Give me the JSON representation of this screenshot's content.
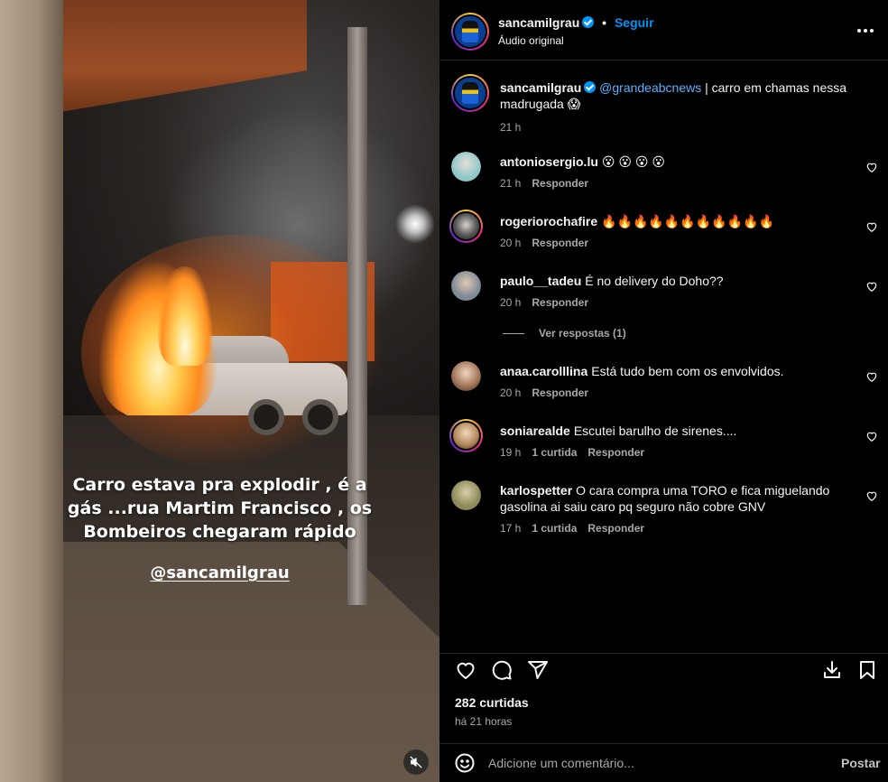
{
  "video": {
    "caption_lines": [
      "Carro estava pra explodir , é a",
      "gás ...rua Martim Francisco , os",
      "Bombeiros chegaram rápido"
    ],
    "handle_tag": "@sancamilgrau"
  },
  "header": {
    "username": "sancamilgrau",
    "separator": "•",
    "follow_label": "Seguir",
    "subtitle": "Áudio original"
  },
  "post": {
    "username": "sancamilgrau",
    "mention": "@grandeabcnews",
    "text": " | carro em chamas nessa madrugada 😱",
    "time": "21 h"
  },
  "comments": [
    {
      "username": "antoniosergio.lu",
      "text": "😮 😮 😮 😮",
      "time": "21 h",
      "likes": "",
      "reply": "Responder",
      "avatar_color": "#8fc7c9"
    },
    {
      "username": "rogeriorochafire",
      "text": "🔥🔥🔥🔥🔥🔥🔥🔥🔥🔥🔥",
      "time": "20 h",
      "likes": "",
      "reply": "Responder",
      "avatar_color": "#9a9a9a"
    },
    {
      "username": "paulo__tadeu",
      "text": "É no delivery do Doho??",
      "time": "20 h",
      "likes": "",
      "reply": "Responder",
      "avatar_color": "#7f8a96"
    },
    {
      "username": "anaa.carolllina",
      "text": "Está tudo bem com os envolvidos.",
      "time": "20 h",
      "likes": "",
      "reply": "Responder",
      "avatar_color": "#a4785a"
    },
    {
      "username": "soniarealde",
      "text": "Escutei barulho de sirenes....",
      "time": "19 h",
      "likes": "1 curtida",
      "reply": "Responder",
      "avatar_color": "#b58a5e"
    },
    {
      "username": "karlospetter",
      "text": "O cara compra uma TORO e fica miguelando gasolina ai saiu caro pq seguro não cobre GNV",
      "time": "17 h",
      "likes": "1 curtida",
      "reply": "Responder",
      "avatar_color": "#8d8a5a"
    }
  ],
  "view_replies_label": "Ver respostas (1)",
  "likes_count": "282 curtidas",
  "posted_ago": "há 21 horas",
  "comment_box": {
    "placeholder": "Adicione um comentário...",
    "post_label": "Postar"
  },
  "colors": {
    "accent": "#0095f6",
    "background": "#000000",
    "secondary_text": "#a8a8a8"
  },
  "icons": [
    "more-options-icon",
    "verified-badge-icon",
    "heart-icon",
    "comment-icon",
    "share-icon",
    "download-icon",
    "bookmark-icon",
    "emoji-icon",
    "mute-icon"
  ]
}
